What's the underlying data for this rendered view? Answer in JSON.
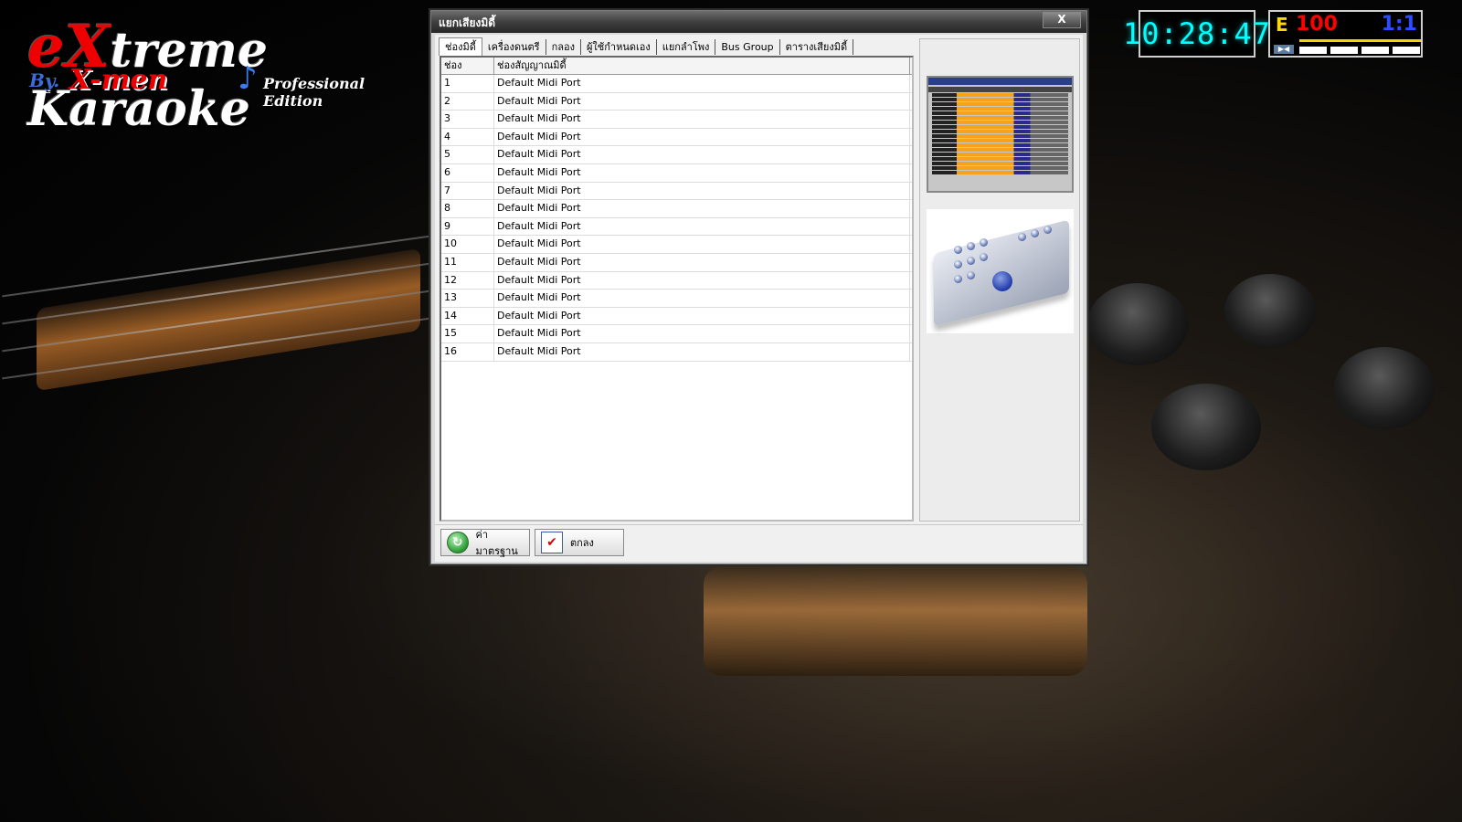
{
  "logo": {
    "brand_x": "eX",
    "brand_rest": "treme Karaoke",
    "by": "By.",
    "men": "X-men",
    "edition": "Professional Edition"
  },
  "clock": {
    "time": "10:28:47"
  },
  "score": {
    "letter": "E",
    "points": "100",
    "ratio": "1:1",
    "playback_icon": "play-pause-icon"
  },
  "dialog": {
    "title": "แยกเสียงมิดี้",
    "close_label": "X",
    "tabs": [
      {
        "label": "ช่องมิดี้",
        "active": true
      },
      {
        "label": "เครื่องดนตรี",
        "active": false
      },
      {
        "label": "กลอง",
        "active": false
      },
      {
        "label": "ผู้ใช้กำหนดเอง",
        "active": false
      },
      {
        "label": "แยกลำโพง",
        "active": false
      },
      {
        "label": "Bus Group",
        "active": false
      },
      {
        "label": "ตารางเสียงมิดี้",
        "active": false
      }
    ],
    "table": {
      "columns": [
        "ช่อง",
        "ช่องสัญญาณมิดี้"
      ],
      "rows": [
        [
          "1",
          "Default Midi Port"
        ],
        [
          "2",
          "Default Midi Port"
        ],
        [
          "3",
          "Default Midi Port"
        ],
        [
          "4",
          "Default Midi Port"
        ],
        [
          "5",
          "Default Midi Port"
        ],
        [
          "6",
          "Default Midi Port"
        ],
        [
          "7",
          "Default Midi Port"
        ],
        [
          "8",
          "Default Midi Port"
        ],
        [
          "9",
          "Default Midi Port"
        ],
        [
          "10",
          "Default Midi Port"
        ],
        [
          "11",
          "Default Midi Port"
        ],
        [
          "12",
          "Default Midi Port"
        ],
        [
          "13",
          "Default Midi Port"
        ],
        [
          "14",
          "Default Midi Port"
        ],
        [
          "15",
          "Default Midi Port"
        ],
        [
          "16",
          "Default Midi Port"
        ]
      ]
    },
    "buttons": {
      "default_label": "ค่ามาตรฐาน",
      "ok_label": "ตกลง"
    }
  }
}
